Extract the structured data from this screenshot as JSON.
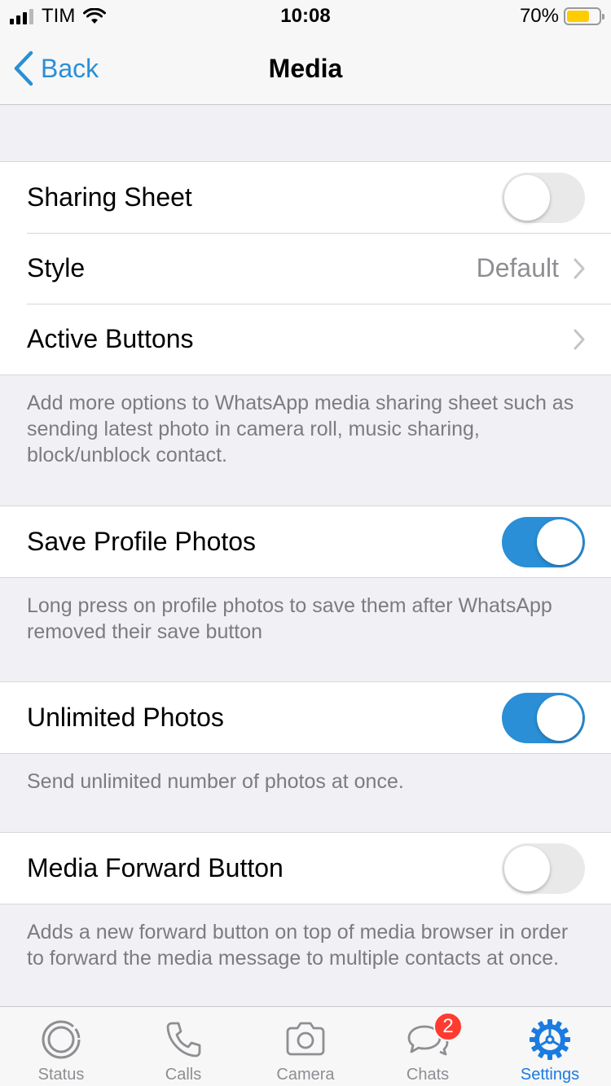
{
  "status_bar": {
    "carrier": "TIM",
    "time": "10:08",
    "battery_percent": "70%",
    "battery_level": 0.7,
    "signal_bars": 3
  },
  "nav": {
    "back_label": "Back",
    "title": "Media"
  },
  "sections": [
    {
      "rows": [
        {
          "label": "Sharing Sheet",
          "type": "toggle",
          "on": false
        },
        {
          "label": "Style",
          "type": "value",
          "value": "Default"
        },
        {
          "label": "Active Buttons",
          "type": "chevron"
        }
      ],
      "footer": "Add more options to WhatsApp media sharing sheet such as sending latest photo in camera roll, music sharing, block/unblock contact."
    },
    {
      "rows": [
        {
          "label": "Save Profile Photos",
          "type": "toggle",
          "on": true
        }
      ],
      "footer": "Long press on profile photos to save them after WhatsApp removed their save button"
    },
    {
      "rows": [
        {
          "label": "Unlimited Photos",
          "type": "toggle",
          "on": true
        }
      ],
      "footer": "Send unlimited number of photos at once."
    },
    {
      "rows": [
        {
          "label": "Media Forward Button",
          "type": "toggle",
          "on": false
        }
      ],
      "footer": "Adds a new forward button on top of media browser in order to forward the media message to multiple contacts at once."
    }
  ],
  "tabs": [
    {
      "label": "Status",
      "icon": "status-icon",
      "active": false
    },
    {
      "label": "Calls",
      "icon": "phone-icon",
      "active": false
    },
    {
      "label": "Camera",
      "icon": "camera-icon",
      "active": false
    },
    {
      "label": "Chats",
      "icon": "chat-bubbles-icon",
      "active": false,
      "badge": "2"
    },
    {
      "label": "Settings",
      "icon": "gear-icon",
      "active": true
    }
  ],
  "colors": {
    "accent": "#2a8fd6",
    "toggle_off": "#e9e9ea",
    "badge": "#ff3b30",
    "battery": "#ffcc00",
    "active_tab": "#1a7be0"
  }
}
